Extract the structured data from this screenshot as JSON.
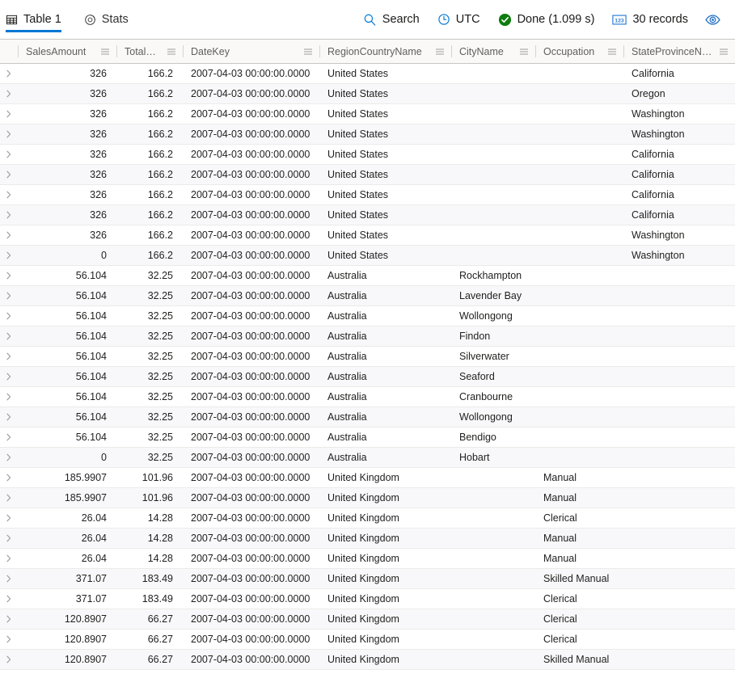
{
  "toolbar": {
    "tabs": [
      {
        "label": "Table 1",
        "icon": "table-icon",
        "active": true
      },
      {
        "label": "Stats",
        "icon": "stats-icon",
        "active": false
      }
    ],
    "search_label": "Search",
    "timezone_label": "UTC",
    "status_label": "Done (1.099 s)",
    "records_label": "30 records",
    "preview_icon": "eye-icon",
    "accent_color": "#0078d4",
    "success_color": "#107c10"
  },
  "table": {
    "columns": [
      {
        "label": "SalesAmount",
        "menu": true,
        "align": "right"
      },
      {
        "label": "TotalCost",
        "menu": true,
        "align": "right"
      },
      {
        "label": "DateKey",
        "menu": true,
        "align": "left"
      },
      {
        "label": "RegionCountryName",
        "menu": true,
        "align": "left"
      },
      {
        "label": "CityName",
        "menu": true,
        "align": "left"
      },
      {
        "label": "Occupation",
        "menu": true,
        "align": "left"
      },
      {
        "label": "StateProvinceName",
        "menu": true,
        "align": "left"
      }
    ],
    "rows": [
      {
        "SalesAmount": "326",
        "TotalCost": "166.2",
        "DateKey": "2007-04-03 00:00:00.0000",
        "RegionCountryName": "United States",
        "CityName": "",
        "Occupation": "",
        "StateProvinceName": "California"
      },
      {
        "SalesAmount": "326",
        "TotalCost": "166.2",
        "DateKey": "2007-04-03 00:00:00.0000",
        "RegionCountryName": "United States",
        "CityName": "",
        "Occupation": "",
        "StateProvinceName": "Oregon"
      },
      {
        "SalesAmount": "326",
        "TotalCost": "166.2",
        "DateKey": "2007-04-03 00:00:00.0000",
        "RegionCountryName": "United States",
        "CityName": "",
        "Occupation": "",
        "StateProvinceName": "Washington"
      },
      {
        "SalesAmount": "326",
        "TotalCost": "166.2",
        "DateKey": "2007-04-03 00:00:00.0000",
        "RegionCountryName": "United States",
        "CityName": "",
        "Occupation": "",
        "StateProvinceName": "Washington"
      },
      {
        "SalesAmount": "326",
        "TotalCost": "166.2",
        "DateKey": "2007-04-03 00:00:00.0000",
        "RegionCountryName": "United States",
        "CityName": "",
        "Occupation": "",
        "StateProvinceName": "California"
      },
      {
        "SalesAmount": "326",
        "TotalCost": "166.2",
        "DateKey": "2007-04-03 00:00:00.0000",
        "RegionCountryName": "United States",
        "CityName": "",
        "Occupation": "",
        "StateProvinceName": "California"
      },
      {
        "SalesAmount": "326",
        "TotalCost": "166.2",
        "DateKey": "2007-04-03 00:00:00.0000",
        "RegionCountryName": "United States",
        "CityName": "",
        "Occupation": "",
        "StateProvinceName": "California"
      },
      {
        "SalesAmount": "326",
        "TotalCost": "166.2",
        "DateKey": "2007-04-03 00:00:00.0000",
        "RegionCountryName": "United States",
        "CityName": "",
        "Occupation": "",
        "StateProvinceName": "California"
      },
      {
        "SalesAmount": "326",
        "TotalCost": "166.2",
        "DateKey": "2007-04-03 00:00:00.0000",
        "RegionCountryName": "United States",
        "CityName": "",
        "Occupation": "",
        "StateProvinceName": "Washington"
      },
      {
        "SalesAmount": "0",
        "TotalCost": "166.2",
        "DateKey": "2007-04-03 00:00:00.0000",
        "RegionCountryName": "United States",
        "CityName": "",
        "Occupation": "",
        "StateProvinceName": "Washington"
      },
      {
        "SalesAmount": "56.104",
        "TotalCost": "32.25",
        "DateKey": "2007-04-03 00:00:00.0000",
        "RegionCountryName": "Australia",
        "CityName": "Rockhampton",
        "Occupation": "",
        "StateProvinceName": ""
      },
      {
        "SalesAmount": "56.104",
        "TotalCost": "32.25",
        "DateKey": "2007-04-03 00:00:00.0000",
        "RegionCountryName": "Australia",
        "CityName": "Lavender Bay",
        "Occupation": "",
        "StateProvinceName": ""
      },
      {
        "SalesAmount": "56.104",
        "TotalCost": "32.25",
        "DateKey": "2007-04-03 00:00:00.0000",
        "RegionCountryName": "Australia",
        "CityName": "Wollongong",
        "Occupation": "",
        "StateProvinceName": ""
      },
      {
        "SalesAmount": "56.104",
        "TotalCost": "32.25",
        "DateKey": "2007-04-03 00:00:00.0000",
        "RegionCountryName": "Australia",
        "CityName": "Findon",
        "Occupation": "",
        "StateProvinceName": ""
      },
      {
        "SalesAmount": "56.104",
        "TotalCost": "32.25",
        "DateKey": "2007-04-03 00:00:00.0000",
        "RegionCountryName": "Australia",
        "CityName": "Silverwater",
        "Occupation": "",
        "StateProvinceName": ""
      },
      {
        "SalesAmount": "56.104",
        "TotalCost": "32.25",
        "DateKey": "2007-04-03 00:00:00.0000",
        "RegionCountryName": "Australia",
        "CityName": "Seaford",
        "Occupation": "",
        "StateProvinceName": ""
      },
      {
        "SalesAmount": "56.104",
        "TotalCost": "32.25",
        "DateKey": "2007-04-03 00:00:00.0000",
        "RegionCountryName": "Australia",
        "CityName": "Cranbourne",
        "Occupation": "",
        "StateProvinceName": ""
      },
      {
        "SalesAmount": "56.104",
        "TotalCost": "32.25",
        "DateKey": "2007-04-03 00:00:00.0000",
        "RegionCountryName": "Australia",
        "CityName": "Wollongong",
        "Occupation": "",
        "StateProvinceName": ""
      },
      {
        "SalesAmount": "56.104",
        "TotalCost": "32.25",
        "DateKey": "2007-04-03 00:00:00.0000",
        "RegionCountryName": "Australia",
        "CityName": "Bendigo",
        "Occupation": "",
        "StateProvinceName": ""
      },
      {
        "SalesAmount": "0",
        "TotalCost": "32.25",
        "DateKey": "2007-04-03 00:00:00.0000",
        "RegionCountryName": "Australia",
        "CityName": "Hobart",
        "Occupation": "",
        "StateProvinceName": ""
      },
      {
        "SalesAmount": "185.9907",
        "TotalCost": "101.96",
        "DateKey": "2007-04-03 00:00:00.0000",
        "RegionCountryName": "United Kingdom",
        "CityName": "",
        "Occupation": "Manual",
        "StateProvinceName": ""
      },
      {
        "SalesAmount": "185.9907",
        "TotalCost": "101.96",
        "DateKey": "2007-04-03 00:00:00.0000",
        "RegionCountryName": "United Kingdom",
        "CityName": "",
        "Occupation": "Manual",
        "StateProvinceName": ""
      },
      {
        "SalesAmount": "26.04",
        "TotalCost": "14.28",
        "DateKey": "2007-04-03 00:00:00.0000",
        "RegionCountryName": "United Kingdom",
        "CityName": "",
        "Occupation": "Clerical",
        "StateProvinceName": ""
      },
      {
        "SalesAmount": "26.04",
        "TotalCost": "14.28",
        "DateKey": "2007-04-03 00:00:00.0000",
        "RegionCountryName": "United Kingdom",
        "CityName": "",
        "Occupation": "Manual",
        "StateProvinceName": ""
      },
      {
        "SalesAmount": "26.04",
        "TotalCost": "14.28",
        "DateKey": "2007-04-03 00:00:00.0000",
        "RegionCountryName": "United Kingdom",
        "CityName": "",
        "Occupation": "Manual",
        "StateProvinceName": ""
      },
      {
        "SalesAmount": "371.07",
        "TotalCost": "183.49",
        "DateKey": "2007-04-03 00:00:00.0000",
        "RegionCountryName": "United Kingdom",
        "CityName": "",
        "Occupation": "Skilled Manual",
        "StateProvinceName": ""
      },
      {
        "SalesAmount": "371.07",
        "TotalCost": "183.49",
        "DateKey": "2007-04-03 00:00:00.0000",
        "RegionCountryName": "United Kingdom",
        "CityName": "",
        "Occupation": "Clerical",
        "StateProvinceName": ""
      },
      {
        "SalesAmount": "120.8907",
        "TotalCost": "66.27",
        "DateKey": "2007-04-03 00:00:00.0000",
        "RegionCountryName": "United Kingdom",
        "CityName": "",
        "Occupation": "Clerical",
        "StateProvinceName": ""
      },
      {
        "SalesAmount": "120.8907",
        "TotalCost": "66.27",
        "DateKey": "2007-04-03 00:00:00.0000",
        "RegionCountryName": "United Kingdom",
        "CityName": "",
        "Occupation": "Clerical",
        "StateProvinceName": ""
      },
      {
        "SalesAmount": "120.8907",
        "TotalCost": "66.27",
        "DateKey": "2007-04-03 00:00:00.0000",
        "RegionCountryName": "United Kingdom",
        "CityName": "",
        "Occupation": "Skilled Manual",
        "StateProvinceName": ""
      }
    ]
  }
}
